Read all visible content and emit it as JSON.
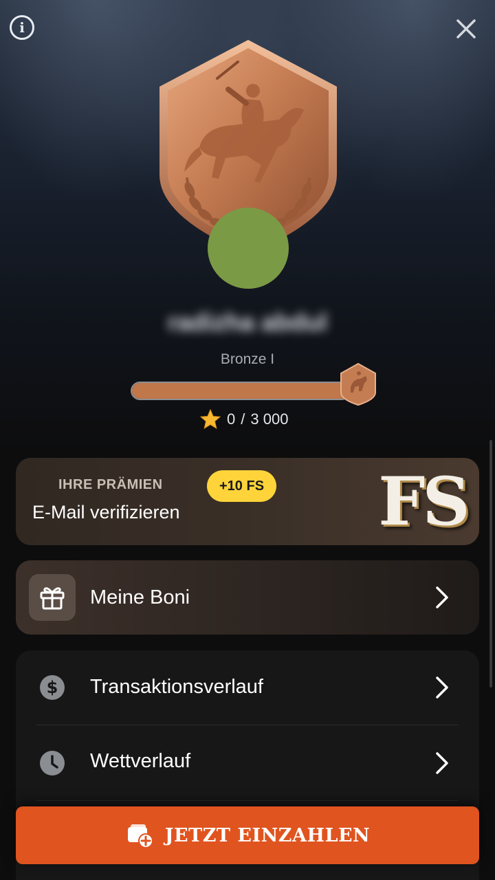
{
  "header": {
    "info_icon": "info-icon",
    "close_icon": "close-icon"
  },
  "profile": {
    "badge_icon": "bronze-polo-shield-icon",
    "avatar_color": "#7b9a45",
    "username": "radizha abdul",
    "level": "Bronze I",
    "progress_fraction": 1.0,
    "points_current": "0",
    "points_separator": "/",
    "points_target": "3 000",
    "points_icon": "star-icon"
  },
  "rewards": {
    "title": "IHRE PRÄMIEN",
    "text": "E-Mail verifizieren",
    "badge": "+10 FS",
    "art_text": "FS"
  },
  "bonus": {
    "label": "Meine Boni",
    "icon": "gift-icon"
  },
  "menu": {
    "items": [
      {
        "label": "Transaktionsverlauf",
        "icon": "dollar-icon"
      },
      {
        "label": "Wettverlauf",
        "icon": "clock-icon"
      }
    ]
  },
  "deposit": {
    "label": "JETZT EINZAHLEN",
    "icon": "wallet-plus-icon"
  },
  "colors": {
    "accent": "#e0541f",
    "pill": "#ffd43a",
    "bronze": "#c0774a"
  }
}
